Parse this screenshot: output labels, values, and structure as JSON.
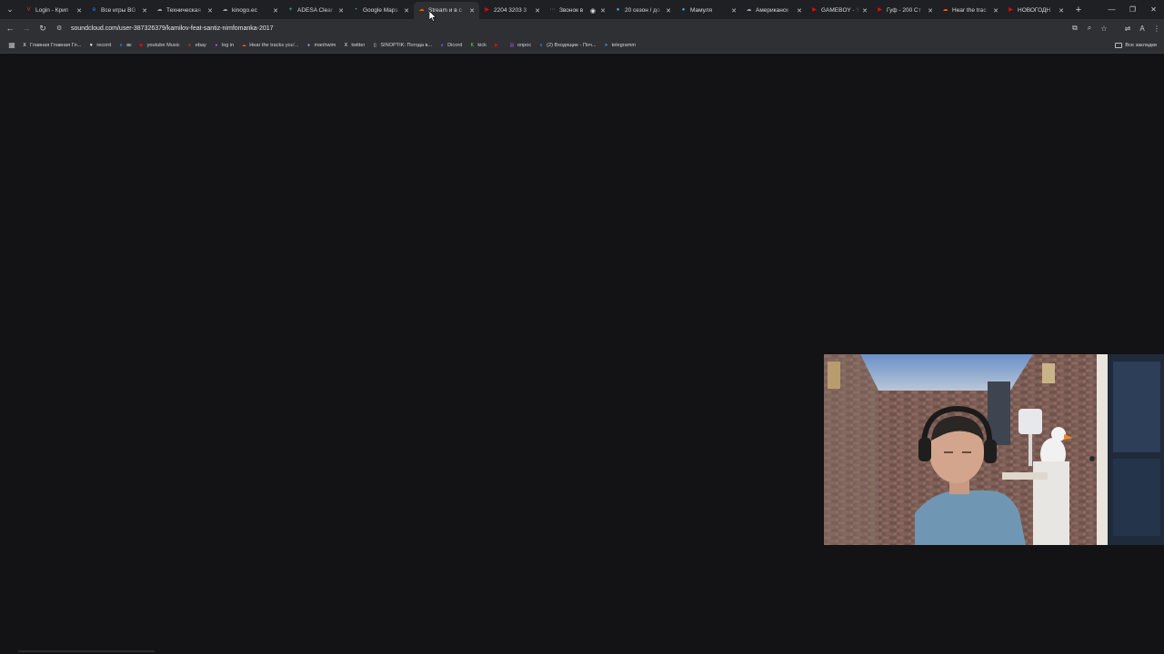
{
  "browser": {
    "tabs": [
      {
        "title": "Login - Крип",
        "favicon": "vivaldi-icon",
        "color": "#e0323c",
        "active": false
      },
      {
        "title": "Все игры BG",
        "favicon": "vk-icon",
        "color": "#2787f5",
        "active": false
      },
      {
        "title": "Техническая",
        "favicon": "cloud-icon",
        "color": "#9aa0a6",
        "active": false
      },
      {
        "title": "kinogo.ec",
        "favicon": "cloud-icon",
        "color": "#9aa0a6",
        "active": false
      },
      {
        "title": "ADESA Clear",
        "favicon": "adesa-icon",
        "color": "#19a974",
        "active": false
      },
      {
        "title": "Google Maps",
        "favicon": "maps-pin-icon",
        "color": "#34a853",
        "active": false
      },
      {
        "title": "Stream и в с",
        "favicon": "soundcloud-icon",
        "color": "#ff5500",
        "active": true
      },
      {
        "title": "2204 3203 3",
        "favicon": "youtube-icon",
        "color": "#ff0000",
        "active": false
      },
      {
        "title": "Звонок в",
        "favicon": "dots-icon",
        "color": "#9aa0a6",
        "active": false,
        "recording": true
      },
      {
        "title": "20 сезон / до",
        "favicon": "globe-icon",
        "color": "#4fa3e0",
        "active": false
      },
      {
        "title": "Мамуля",
        "favicon": "globe-icon",
        "color": "#4fa3e0",
        "active": false
      },
      {
        "title": "Американск",
        "favicon": "cloud-icon",
        "color": "#9aa0a6",
        "active": false
      },
      {
        "title": "GAMEBOY - Y",
        "favicon": "youtube-icon",
        "color": "#ff0000",
        "active": false
      },
      {
        "title": "Гуф - 200 Ст",
        "favicon": "youtube-icon",
        "color": "#ff0000",
        "active": false
      },
      {
        "title": "Hear the trac",
        "favicon": "soundcloud-icon",
        "color": "#ff5500",
        "active": false
      },
      {
        "title": "НОВОГОДН",
        "favicon": "youtube-icon",
        "color": "#ff0000",
        "active": false
      }
    ],
    "url": "soundcloud.com/user-387326379/kamilov-feat-santiz-nimfomanka-2017",
    "bookmarks": [
      {
        "label": "Главная Главная Гл...",
        "icon": "x-icon",
        "color": "#ffffff"
      },
      {
        "label": "record",
        "icon": "heart-icon",
        "color": "#ffffff"
      },
      {
        "label": "вк",
        "icon": "vk-icon",
        "color": "#2787f5"
      },
      {
        "label": "youtube Music",
        "icon": "youtube-music-icon",
        "color": "#ff0000"
      },
      {
        "label": "ebay",
        "icon": "ebay-icon",
        "color": "#e53238"
      },
      {
        "label": "log in",
        "icon": "login-icon",
        "color": "#a855f7"
      },
      {
        "label": "Hear the tracks you'...",
        "icon": "soundcloud-icon",
        "color": "#ff5500"
      },
      {
        "label": "manhwim",
        "icon": "globe-icon",
        "color": "#8ab4f8"
      },
      {
        "label": "twitter",
        "icon": "x-icon",
        "color": "#ffffff"
      },
      {
        "label": "SINOPTIK: Погода в...",
        "icon": "page-icon",
        "color": "#ffffff"
      },
      {
        "label": "Dicord",
        "icon": "discord-icon",
        "color": "#5865f2"
      },
      {
        "label": "kick",
        "icon": "kick-icon",
        "color": "#53fc18"
      },
      {
        "label": "",
        "icon": "youtube-icon",
        "color": "#ff0000"
      },
      {
        "label": "опрос",
        "icon": "form-icon",
        "color": "#a855f7"
      },
      {
        "label": "(2) Входящие - Поч...",
        "icon": "vk-mail-icon",
        "color": "#2787f5"
      },
      {
        "label": "telegramm",
        "icon": "telegram-icon",
        "color": "#29a9eb"
      }
    ],
    "all_bookmarks_label": "Все закладки"
  },
  "colors": {
    "page_bg": "#131315",
    "tabbar_bg": "#1f2023",
    "toolbar_bg": "#2f3034"
  }
}
